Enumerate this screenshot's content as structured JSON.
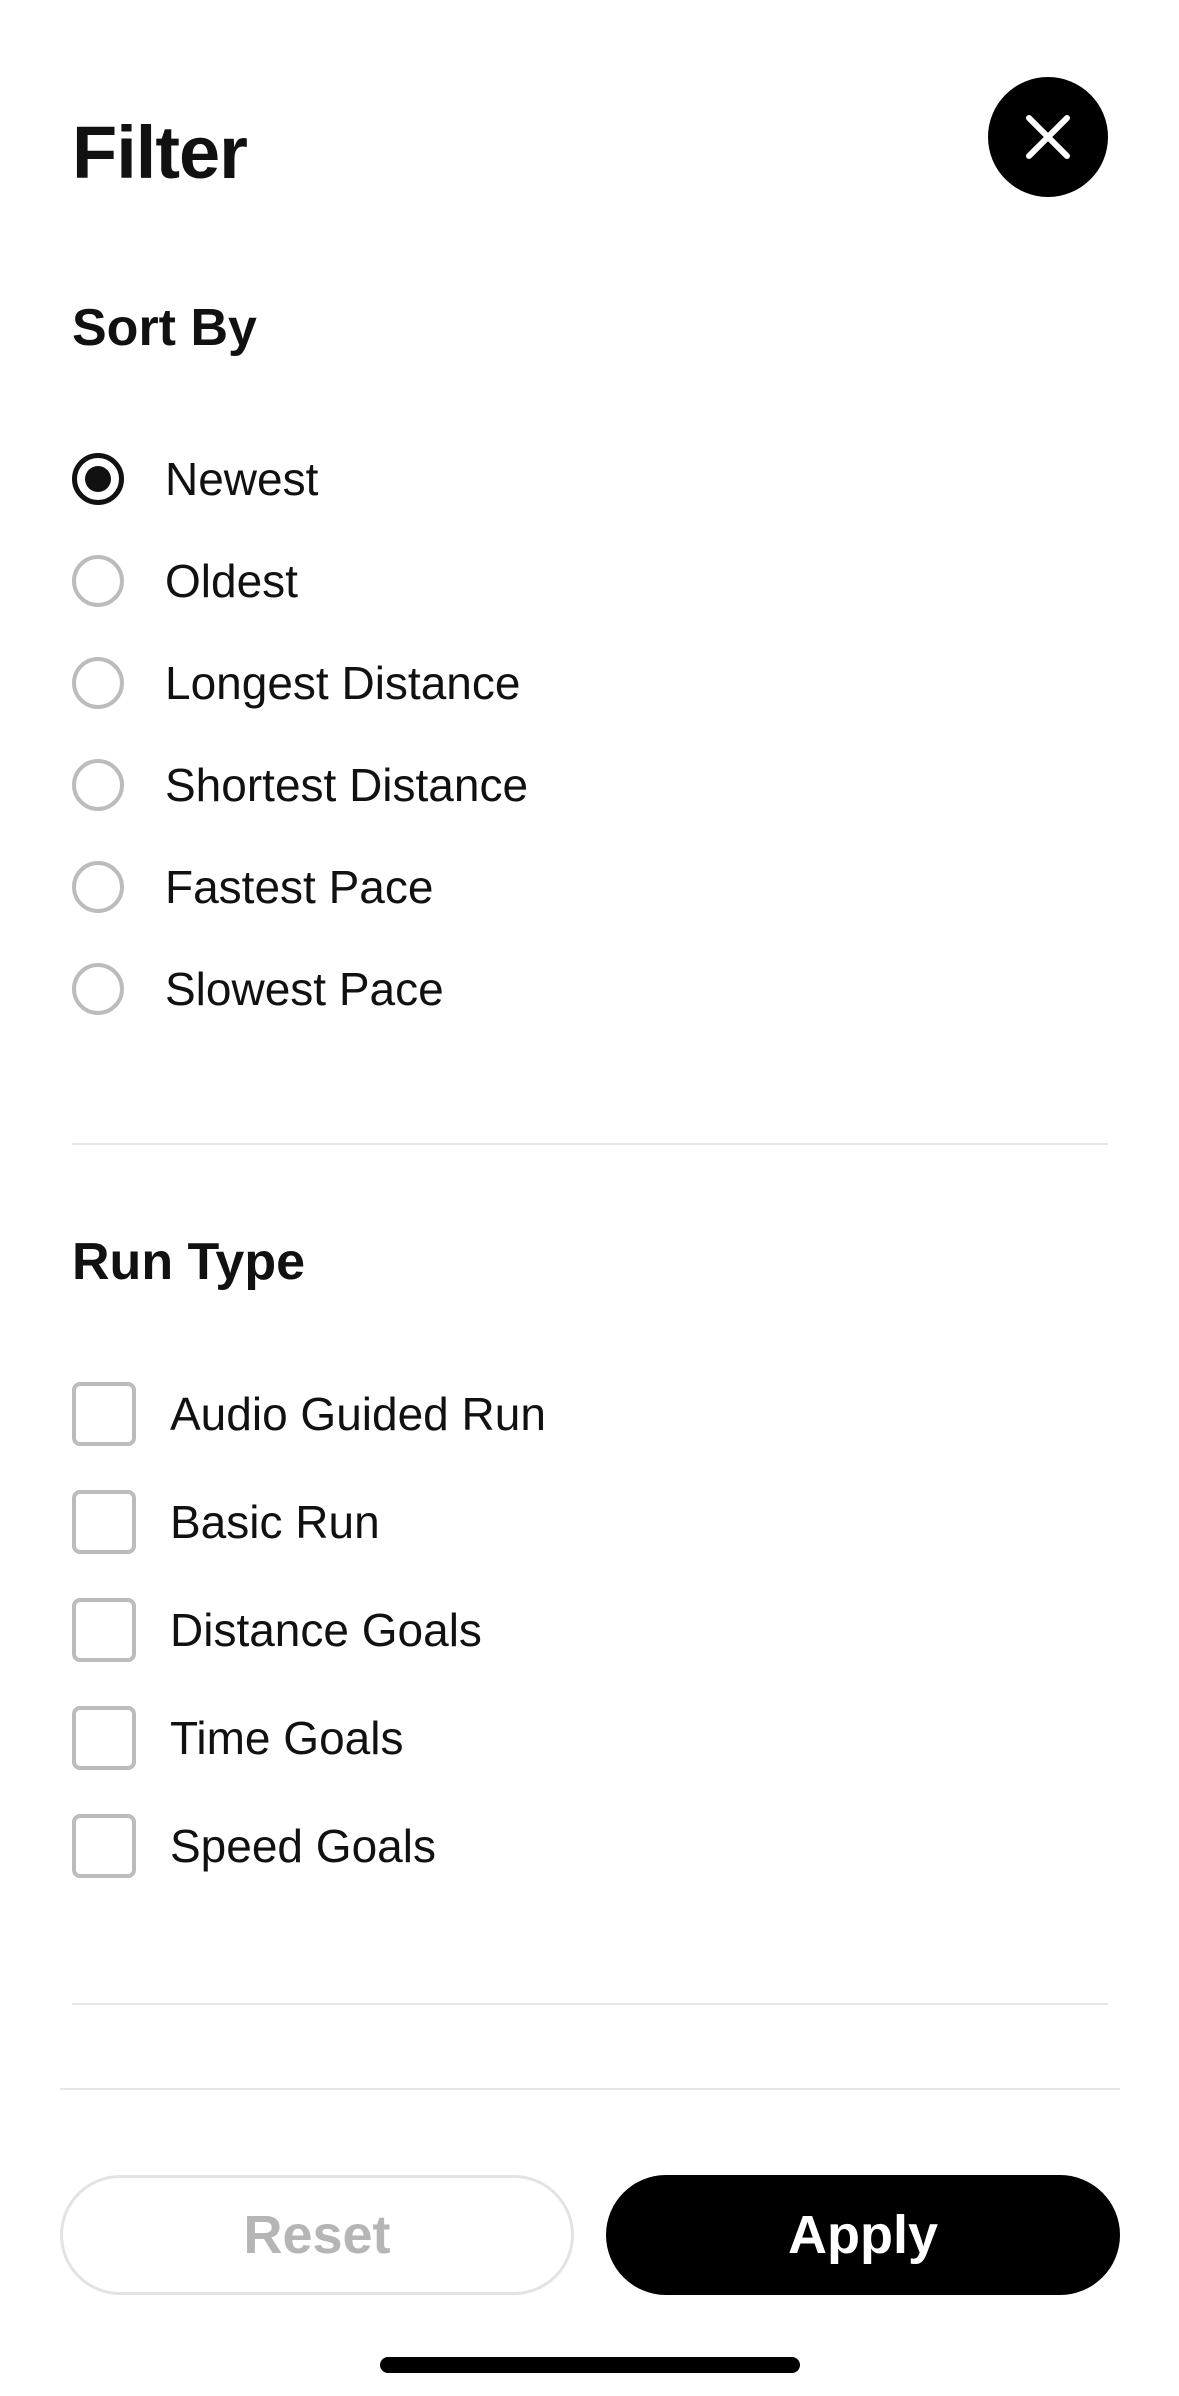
{
  "header": {
    "title": "Filter",
    "close_icon": "close-icon"
  },
  "sort_by": {
    "title": "Sort By",
    "selected": "Newest",
    "options": [
      {
        "label": "Newest",
        "selected": true
      },
      {
        "label": "Oldest",
        "selected": false
      },
      {
        "label": "Longest Distance",
        "selected": false
      },
      {
        "label": "Shortest Distance",
        "selected": false
      },
      {
        "label": "Fastest Pace",
        "selected": false
      },
      {
        "label": "Slowest Pace",
        "selected": false
      }
    ]
  },
  "run_type": {
    "title": "Run Type",
    "options": [
      {
        "label": "Audio Guided Run",
        "checked": false
      },
      {
        "label": "Basic Run",
        "checked": false
      },
      {
        "label": "Distance Goals",
        "checked": false
      },
      {
        "label": "Time Goals",
        "checked": false
      },
      {
        "label": "Speed Goals",
        "checked": false
      }
    ]
  },
  "footer": {
    "reset_label": "Reset",
    "apply_label": "Apply"
  },
  "colors": {
    "primary": "#000000",
    "background": "#ffffff",
    "inactive_border": "#bcbcbc",
    "disabled_text": "#b5b5b5",
    "divider": "#e6e6e6"
  }
}
